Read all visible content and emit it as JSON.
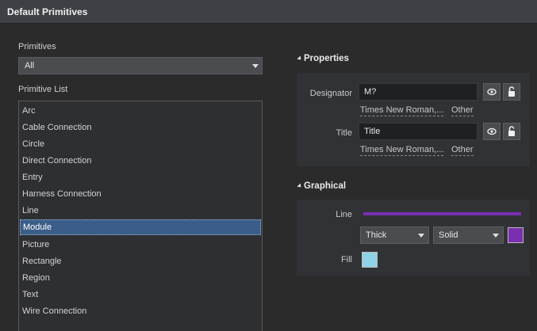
{
  "window": {
    "title": "Default Primitives"
  },
  "left": {
    "primitives_label": "Primitives",
    "primitives_value": "All",
    "list_label": "Primitive List",
    "items": [
      "Arc",
      "Cable Connection",
      "Circle",
      "Direct Connection",
      "Entry",
      "Harness Connection",
      "Line",
      "Module",
      "Picture",
      "Rectangle",
      "Region",
      "Text",
      "Wire Connection"
    ],
    "selected_index": 7
  },
  "properties": {
    "heading": "Properties",
    "designator": {
      "label": "Designator",
      "value": "M?",
      "font": "Times New Roman,...",
      "other": "Other"
    },
    "title": {
      "label": "Title",
      "value": "Title",
      "font": "Times New Roman,...",
      "other": "Other"
    }
  },
  "graphical": {
    "heading": "Graphical",
    "line_label": "Line",
    "line_width": "Thick",
    "line_style": "Solid",
    "line_color": "#7a2fb0",
    "fill_label": "Fill",
    "fill_color": "#8fd3e6"
  },
  "icons": [
    "collapse-triangle-icon",
    "eye-icon",
    "lock-icon",
    "chevron-down-icon"
  ]
}
